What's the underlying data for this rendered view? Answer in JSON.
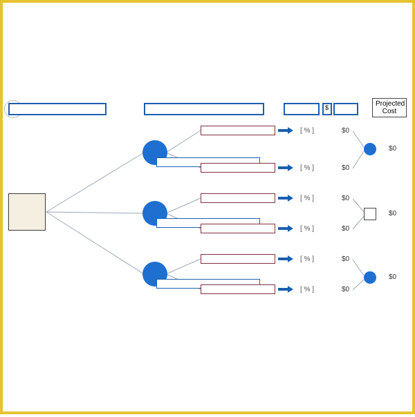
{
  "header": {
    "projected_cost_label": "Projected Cost",
    "currency_symbol": "$"
  },
  "root": {},
  "chances": [
    {
      "leaves": [
        {
          "pct_label": "[   %  ]",
          "cost": "$0"
        },
        {
          "pct_label": "[   %  ]",
          "cost": "$0"
        }
      ],
      "terminal": {
        "shape": "circle",
        "projected": "$0"
      }
    },
    {
      "leaves": [
        {
          "pct_label": "[   %  ]",
          "cost": "$0"
        },
        {
          "pct_label": "[   %  ]",
          "cost": "$0"
        }
      ],
      "terminal": {
        "shape": "square",
        "projected": "$0"
      }
    },
    {
      "leaves": [
        {
          "pct_label": "[   %  ]",
          "cost": "$0"
        },
        {
          "pct_label": "[   %  ]",
          "cost": "$0"
        }
      ],
      "terminal": {
        "shape": "circle",
        "projected": "$0"
      }
    }
  ]
}
